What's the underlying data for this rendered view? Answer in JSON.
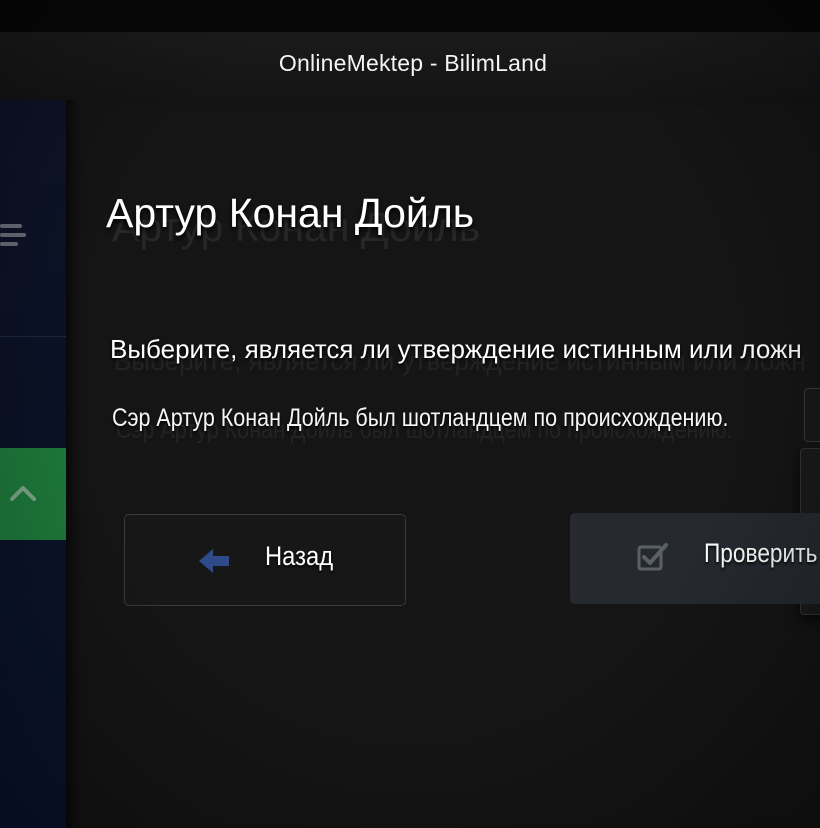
{
  "window": {
    "title": "OnlineMektep - BilimLand"
  },
  "lesson": {
    "title": "Артур Конан Дойль"
  },
  "question": {
    "instruction": "Выберите, является ли утверждение истинным или ложн",
    "statement": "Сэр Артур Конан Дойль был шотландцем по происхождению."
  },
  "buttons": {
    "back_label": "Назад",
    "check_label": "Проверить л"
  },
  "icons": {
    "sidebar_menu": "menu-icon",
    "sidebar_collapse": "chevron-up-icon",
    "back": "arrow-left-icon",
    "check": "checkbox-icon"
  },
  "colors": {
    "sidebar_bg": "#0b1226",
    "sidebar_active": "#1e7a3c",
    "back_arrow": "#2e4a8a",
    "check_button_bg": "#262a30"
  }
}
